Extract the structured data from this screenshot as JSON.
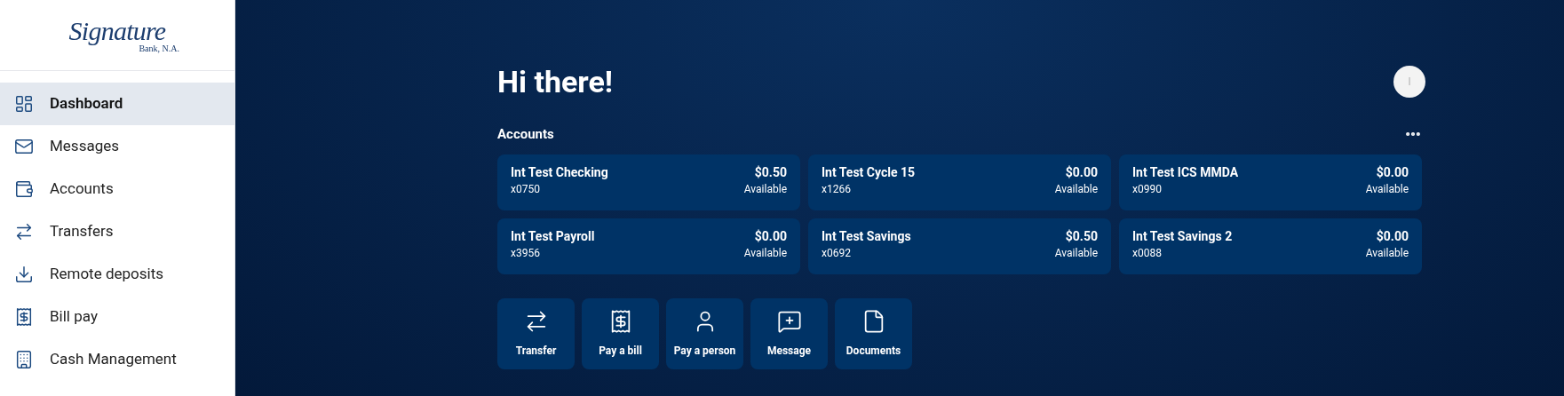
{
  "logo": {
    "script": "Signature",
    "subtitle": "Bank, N.A."
  },
  "sidebar": {
    "items": [
      {
        "label": "Dashboard",
        "selected": true
      },
      {
        "label": "Messages",
        "selected": false
      },
      {
        "label": "Accounts",
        "selected": false
      },
      {
        "label": "Transfers",
        "selected": false
      },
      {
        "label": "Remote deposits",
        "selected": false
      },
      {
        "label": "Bill pay",
        "selected": false
      },
      {
        "label": "Cash Management",
        "selected": false
      }
    ]
  },
  "greeting": "Hi there!",
  "avatar": {
    "initial": "I"
  },
  "accounts": {
    "title": "Accounts",
    "items": [
      {
        "name": "Int Test Checking",
        "number": "x0750",
        "balance": "$0.50",
        "status": "Available"
      },
      {
        "name": "Int Test Cycle 15",
        "number": "x1266",
        "balance": "$0.00",
        "status": "Available"
      },
      {
        "name": "Int Test ICS MMDA",
        "number": "x0990",
        "balance": "$0.00",
        "status": "Available"
      },
      {
        "name": "Int Test Payroll",
        "number": "x3956",
        "balance": "$0.00",
        "status": "Available"
      },
      {
        "name": "Int Test Savings",
        "number": "x0692",
        "balance": "$0.50",
        "status": "Available"
      },
      {
        "name": "Int Test Savings 2",
        "number": "x0088",
        "balance": "$0.00",
        "status": "Available"
      }
    ]
  },
  "quick_actions": [
    {
      "label": "Transfer"
    },
    {
      "label": "Pay a bill"
    },
    {
      "label": "Pay a person"
    },
    {
      "label": "Message"
    },
    {
      "label": "Documents"
    }
  ]
}
